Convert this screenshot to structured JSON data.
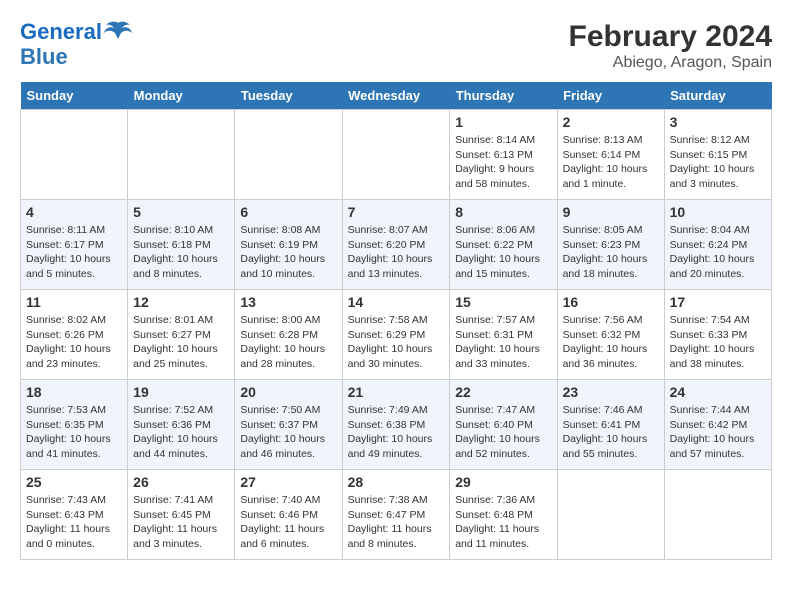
{
  "header": {
    "logo_line1": "General",
    "logo_line2": "Blue",
    "title": "February 2024",
    "subtitle": "Abiego, Aragon, Spain"
  },
  "columns": [
    "Sunday",
    "Monday",
    "Tuesday",
    "Wednesday",
    "Thursday",
    "Friday",
    "Saturday"
  ],
  "weeks": [
    {
      "days": [
        {
          "num": "",
          "info": "",
          "empty": true
        },
        {
          "num": "",
          "info": "",
          "empty": true
        },
        {
          "num": "",
          "info": "",
          "empty": true
        },
        {
          "num": "",
          "info": "",
          "empty": true
        },
        {
          "num": "1",
          "info": "Sunrise: 8:14 AM\nSunset: 6:13 PM\nDaylight: 9 hours and 58 minutes."
        },
        {
          "num": "2",
          "info": "Sunrise: 8:13 AM\nSunset: 6:14 PM\nDaylight: 10 hours and 1 minute."
        },
        {
          "num": "3",
          "info": "Sunrise: 8:12 AM\nSunset: 6:15 PM\nDaylight: 10 hours and 3 minutes."
        }
      ]
    },
    {
      "days": [
        {
          "num": "4",
          "info": "Sunrise: 8:11 AM\nSunset: 6:17 PM\nDaylight: 10 hours and 5 minutes."
        },
        {
          "num": "5",
          "info": "Sunrise: 8:10 AM\nSunset: 6:18 PM\nDaylight: 10 hours and 8 minutes."
        },
        {
          "num": "6",
          "info": "Sunrise: 8:08 AM\nSunset: 6:19 PM\nDaylight: 10 hours and 10 minutes."
        },
        {
          "num": "7",
          "info": "Sunrise: 8:07 AM\nSunset: 6:20 PM\nDaylight: 10 hours and 13 minutes."
        },
        {
          "num": "8",
          "info": "Sunrise: 8:06 AM\nSunset: 6:22 PM\nDaylight: 10 hours and 15 minutes."
        },
        {
          "num": "9",
          "info": "Sunrise: 8:05 AM\nSunset: 6:23 PM\nDaylight: 10 hours and 18 minutes."
        },
        {
          "num": "10",
          "info": "Sunrise: 8:04 AM\nSunset: 6:24 PM\nDaylight: 10 hours and 20 minutes."
        }
      ]
    },
    {
      "days": [
        {
          "num": "11",
          "info": "Sunrise: 8:02 AM\nSunset: 6:26 PM\nDaylight: 10 hours and 23 minutes."
        },
        {
          "num": "12",
          "info": "Sunrise: 8:01 AM\nSunset: 6:27 PM\nDaylight: 10 hours and 25 minutes."
        },
        {
          "num": "13",
          "info": "Sunrise: 8:00 AM\nSunset: 6:28 PM\nDaylight: 10 hours and 28 minutes."
        },
        {
          "num": "14",
          "info": "Sunrise: 7:58 AM\nSunset: 6:29 PM\nDaylight: 10 hours and 30 minutes."
        },
        {
          "num": "15",
          "info": "Sunrise: 7:57 AM\nSunset: 6:31 PM\nDaylight: 10 hours and 33 minutes."
        },
        {
          "num": "16",
          "info": "Sunrise: 7:56 AM\nSunset: 6:32 PM\nDaylight: 10 hours and 36 minutes."
        },
        {
          "num": "17",
          "info": "Sunrise: 7:54 AM\nSunset: 6:33 PM\nDaylight: 10 hours and 38 minutes."
        }
      ]
    },
    {
      "days": [
        {
          "num": "18",
          "info": "Sunrise: 7:53 AM\nSunset: 6:35 PM\nDaylight: 10 hours and 41 minutes."
        },
        {
          "num": "19",
          "info": "Sunrise: 7:52 AM\nSunset: 6:36 PM\nDaylight: 10 hours and 44 minutes."
        },
        {
          "num": "20",
          "info": "Sunrise: 7:50 AM\nSunset: 6:37 PM\nDaylight: 10 hours and 46 minutes."
        },
        {
          "num": "21",
          "info": "Sunrise: 7:49 AM\nSunset: 6:38 PM\nDaylight: 10 hours and 49 minutes."
        },
        {
          "num": "22",
          "info": "Sunrise: 7:47 AM\nSunset: 6:40 PM\nDaylight: 10 hours and 52 minutes."
        },
        {
          "num": "23",
          "info": "Sunrise: 7:46 AM\nSunset: 6:41 PM\nDaylight: 10 hours and 55 minutes."
        },
        {
          "num": "24",
          "info": "Sunrise: 7:44 AM\nSunset: 6:42 PM\nDaylight: 10 hours and 57 minutes."
        }
      ]
    },
    {
      "days": [
        {
          "num": "25",
          "info": "Sunrise: 7:43 AM\nSunset: 6:43 PM\nDaylight: 11 hours and 0 minutes."
        },
        {
          "num": "26",
          "info": "Sunrise: 7:41 AM\nSunset: 6:45 PM\nDaylight: 11 hours and 3 minutes."
        },
        {
          "num": "27",
          "info": "Sunrise: 7:40 AM\nSunset: 6:46 PM\nDaylight: 11 hours and 6 minutes."
        },
        {
          "num": "28",
          "info": "Sunrise: 7:38 AM\nSunset: 6:47 PM\nDaylight: 11 hours and 8 minutes."
        },
        {
          "num": "29",
          "info": "Sunrise: 7:36 AM\nSunset: 6:48 PM\nDaylight: 11 hours and 11 minutes."
        },
        {
          "num": "",
          "info": "",
          "empty": true
        },
        {
          "num": "",
          "info": "",
          "empty": true
        }
      ]
    }
  ]
}
